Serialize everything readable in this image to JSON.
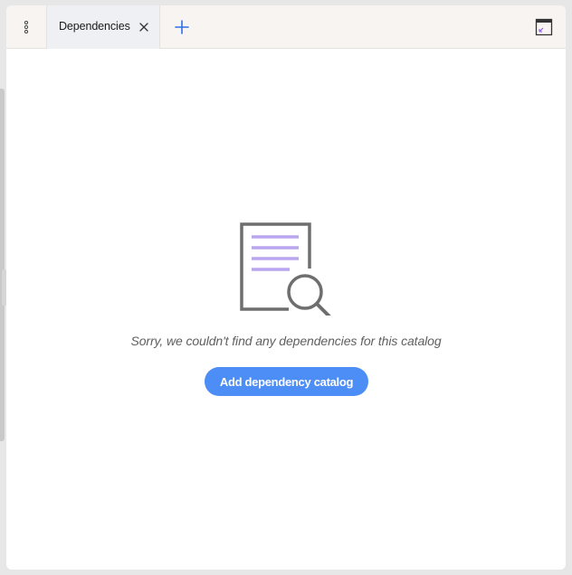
{
  "tabbar": {
    "more_icon": "vertical-dots-icon",
    "tabs": [
      {
        "label": "Dependencies",
        "active": true,
        "close_icon": "close-icon"
      }
    ],
    "add_icon": "plus-icon",
    "window_icon": "window-resize-icon"
  },
  "empty_state": {
    "illustration_icon": "document-search-icon",
    "message": "Sorry, we couldn't find any dependencies for this catalog",
    "action_label": "Add dependency catalog"
  },
  "colors": {
    "accent": "#4c8df6",
    "add_icon": "#2f6fe4",
    "illustration_lines": "#b9a6ef",
    "illustration_stroke": "#6e6e6e",
    "tabbar_bg": "#f7f4f1",
    "active_tab_bg": "#eef0f3"
  }
}
